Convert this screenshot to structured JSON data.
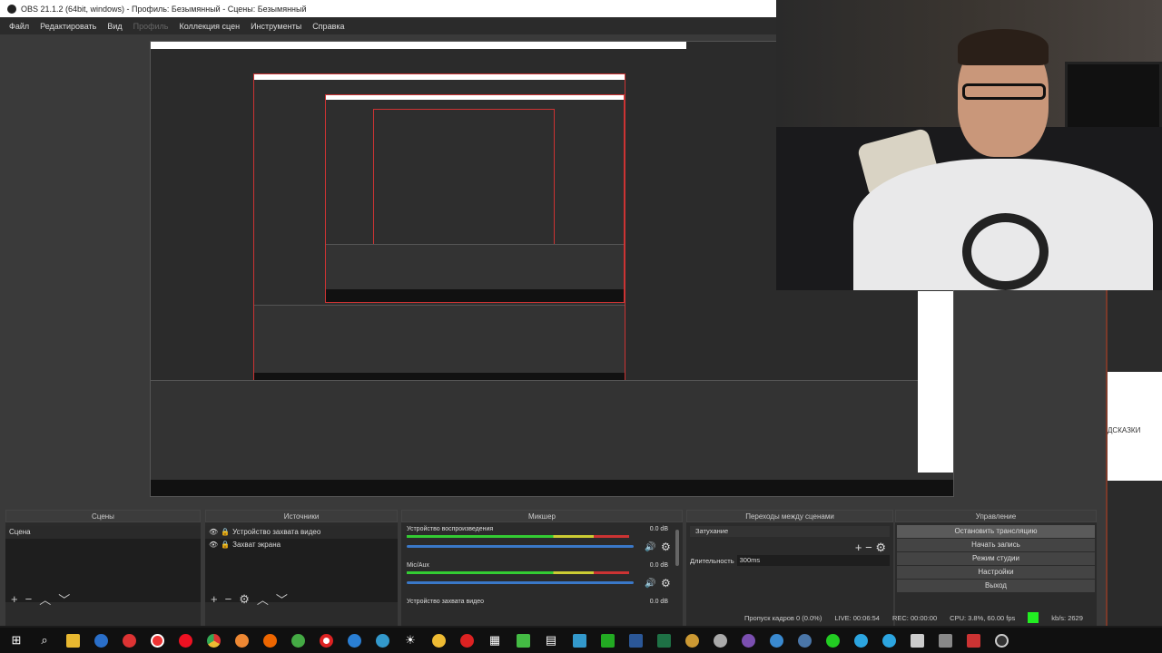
{
  "window": {
    "title": "OBS 21.1.2 (64bit, windows) - Профиль: Безымянный - Сцены: Безымянный"
  },
  "menu": [
    "Файл",
    "Редактировать",
    "Вид",
    "Профиль",
    "Коллекция сцен",
    "Инструменты",
    "Справка"
  ],
  "scenes": {
    "title": "Сцены",
    "items": [
      "Сцена"
    ]
  },
  "sources": {
    "title": "Источники",
    "items": [
      "Устройство захвата видео",
      "Захват экрана"
    ]
  },
  "mixer": {
    "title": "Микшер",
    "channels": [
      {
        "name": "Устройство воспроизведения",
        "db": "0.0 dB",
        "level": 0.84
      },
      {
        "name": "Mic/Aux",
        "db": "0.0 dB",
        "level": 0.84
      },
      {
        "name": "Устройство захвата видео",
        "db": "0.0 dB"
      }
    ]
  },
  "transitions": {
    "title": "Переходы между сценами",
    "selected": "Затухание",
    "duration_label": "Длительность",
    "duration": "300ms"
  },
  "controls": {
    "title": "Управление",
    "buttons": [
      "Остановить трансляцию",
      "Начать запись",
      "Режим студии",
      "Настройки",
      "Выход"
    ]
  },
  "status": {
    "dropped": "Пропуск кадров 0 (0.0%)",
    "live": "LIVE: 00:06:54",
    "rec": "REC: 00:00:00",
    "cpu": "CPU: 3.8%, 60.00 fps",
    "kbps": "kb/s: 2629",
    "indicator_color": "#22ee22"
  },
  "side": {
    "hint": "ДСКАЗКИ"
  }
}
